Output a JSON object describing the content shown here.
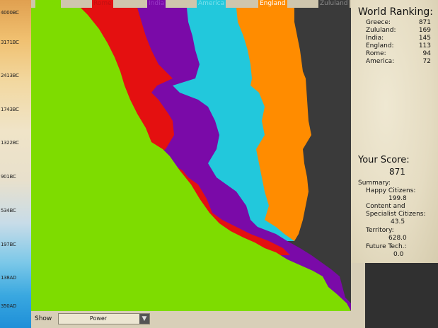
{
  "timeline": {
    "ticks": [
      "4000BC",
      "3171BC",
      "2413BC",
      "1743BC",
      "1322BC",
      "901BC",
      "534BC",
      "197BC",
      "138AD",
      "350AD"
    ]
  },
  "civs": [
    {
      "name": "Greece",
      "color": "#7edc00"
    },
    {
      "name": "Rome",
      "color": "#e41010"
    },
    {
      "name": "India",
      "color": "#7a0aa8"
    },
    {
      "name": "America",
      "color": "#22c8dc"
    },
    {
      "name": "England",
      "color": "#ff8c00"
    },
    {
      "name": "Zululand",
      "color": "#3a3a3a"
    }
  ],
  "ranking": {
    "title": "World Ranking:",
    "rows": [
      {
        "name": "Greece:",
        "value": "871"
      },
      {
        "name": "Zululand:",
        "value": "169"
      },
      {
        "name": "India:",
        "value": "145"
      },
      {
        "name": "England:",
        "value": "113"
      },
      {
        "name": "Rome:",
        "value": "94"
      },
      {
        "name": "America:",
        "value": "72"
      }
    ]
  },
  "score": {
    "title": "Your Score:",
    "value": "871",
    "summary_label": "Summary:",
    "happy_label": "Happy Citizens:",
    "happy_value": "199.8",
    "content_label_1": "Content and",
    "content_label_2": "Specialist Citizens:",
    "content_value": "43.5",
    "territory_label": "Territory:",
    "territory_value": "628.0",
    "future_label": "Future Tech.:",
    "future_value": "0.0"
  },
  "controls": {
    "show_label": "Show",
    "show_value": "Power",
    "arrow": "▼"
  }
}
